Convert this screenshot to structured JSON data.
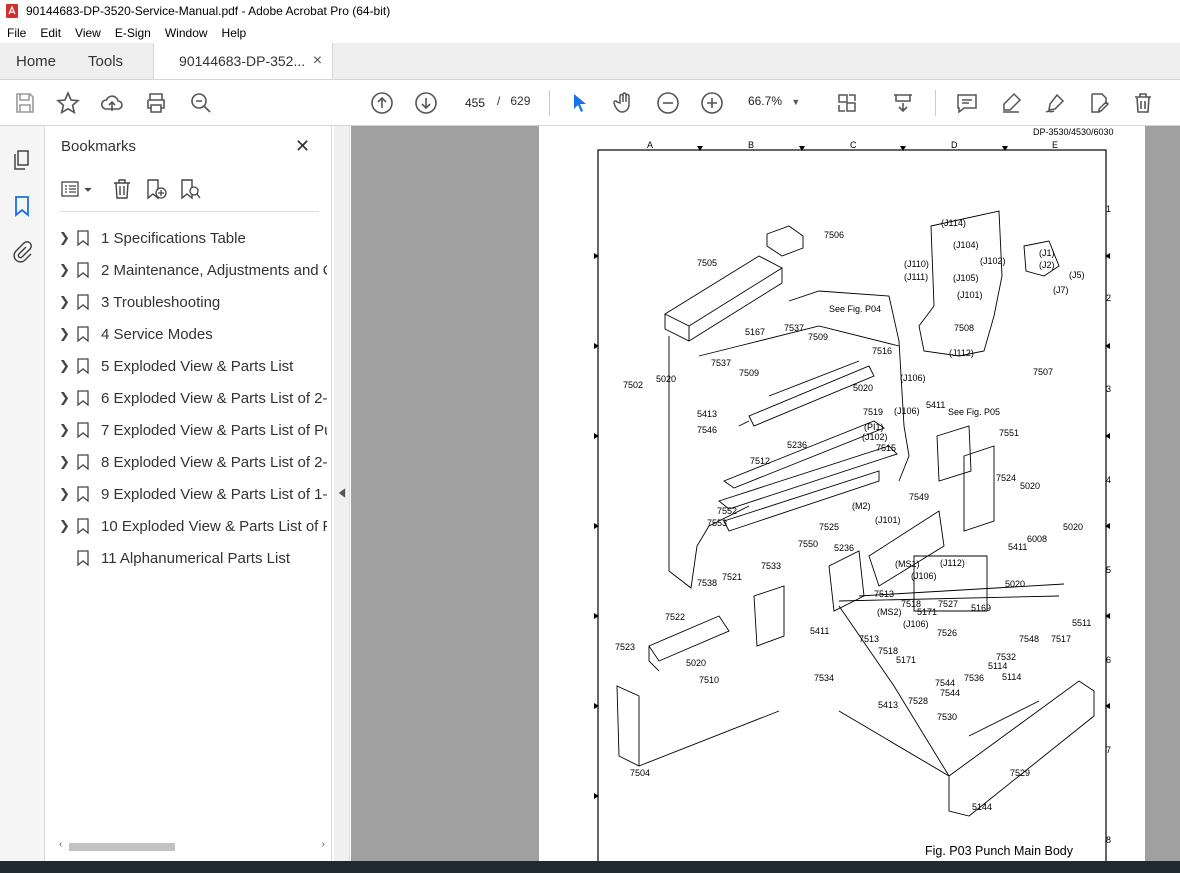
{
  "window": {
    "title": "90144683-DP-3520-Service-Manual.pdf - Adobe Acrobat Pro (64-bit)"
  },
  "menu": [
    "File",
    "Edit",
    "View",
    "E-Sign",
    "Window",
    "Help"
  ],
  "tabs": {
    "home": "Home",
    "tools": "Tools",
    "document": "90144683-DP-352...",
    "close": "×"
  },
  "toolbar": {
    "page_current": "455",
    "page_sep": "/",
    "page_total": "629",
    "zoom": "66.7%"
  },
  "bookmarks": {
    "title": "Bookmarks",
    "close": "✕",
    "items": [
      {
        "label": "1 Specifications Table",
        "expandable": true
      },
      {
        "label": "2 Maintenance, Adjustments and C",
        "expandable": true
      },
      {
        "label": "3 Troubleshooting",
        "expandable": true
      },
      {
        "label": "4 Service Modes",
        "expandable": true
      },
      {
        "label": "5 Exploded View & Parts List",
        "expandable": true
      },
      {
        "label": "6 Exploded View & Parts List of 2-",
        "expandable": true
      },
      {
        "label": "7 Exploded View & Parts List of Pu",
        "expandable": true
      },
      {
        "label": "8 Exploded View & Parts List of 2-",
        "expandable": true
      },
      {
        "label": "9 Exploded View & Parts List of 1-",
        "expandable": true
      },
      {
        "label": "10 Exploded View & Parts List of P",
        "expandable": true
      },
      {
        "label": "11 Alphanumerical Parts List",
        "expandable": false
      }
    ]
  },
  "document_page": {
    "model_header": "DP-3530/4530/6030",
    "column_letters": [
      "A",
      "B",
      "C",
      "D",
      "E"
    ],
    "row_numbers": [
      "1",
      "2",
      "3",
      "4",
      "5",
      "6",
      "7",
      "8"
    ],
    "caption": "Fig. P03 Punch Main Body",
    "callouts": [
      "7506",
      "7505",
      "5167",
      "7537",
      "7509",
      "7516",
      "See Fig. P04",
      "7502",
      "5020",
      "7537",
      "7509",
      "5020",
      "7519",
      "(J106)",
      "(J106)",
      "5411",
      "See Fig. P05",
      "5413",
      "7546",
      "(PI1)",
      "(J102)",
      "7515",
      "5236",
      "7551",
      "7512",
      "7524",
      "5020",
      "7549",
      "7552",
      "(M2)",
      "(J101)",
      "7553",
      "7525",
      "5236",
      "5411",
      "6008",
      "5020",
      "7550",
      "(MS1)",
      "(J112)",
      "7533",
      "(J106)",
      "5020",
      "7538",
      "7521",
      "7513",
      "7518",
      "5171",
      "7527",
      "5169",
      "7522",
      "5411",
      "(MS2)",
      "(J106)",
      "7526",
      "7548",
      "7517",
      "5511",
      "7523",
      "7513",
      "7518",
      "5171",
      "7532",
      "5020",
      "7510",
      "7534",
      "7536",
      "5114",
      "5114",
      "7544",
      "7528",
      "5413",
      "7544",
      "7530",
      "7529",
      "7504",
      "5144",
      "(J114)",
      "(J104)",
      "(J110)",
      "(J111)",
      "(J105)",
      "(J102)",
      "(J1)",
      "(J2)",
      "(J5)",
      "(J7)",
      "(J101)",
      "7508",
      "(J112)",
      "7507"
    ]
  },
  "colors": {
    "accent": "#1473e6",
    "viewer_bg": "#a0a0a0",
    "panel_bg": "#ffffff"
  }
}
